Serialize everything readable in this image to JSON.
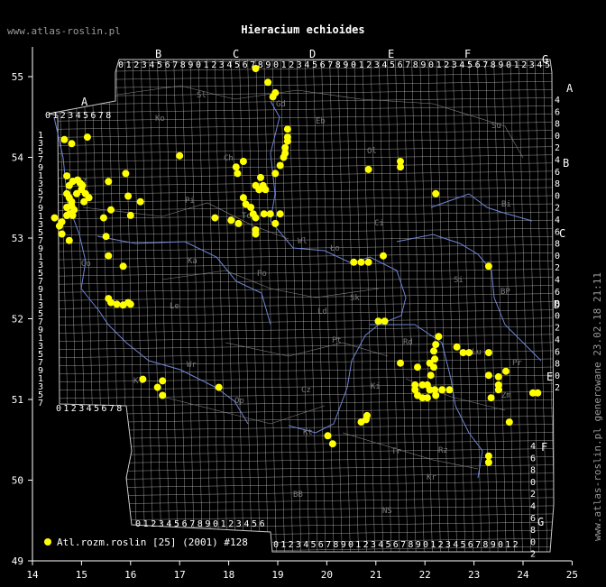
{
  "site_url": "www.atlas-roslin.pl",
  "title": "Hieracium echioides",
  "side_stamp": "www.atlas-roslin.pl generowane 23.02.18 21:11",
  "legend": {
    "label": "Atl.rozm.roslin [25] (2001) #128",
    "color": "#ffff00"
  },
  "axes": {
    "lon_ticks": [
      "14",
      "15",
      "16",
      "17",
      "18",
      "19",
      "20",
      "21",
      "22",
      "23",
      "24",
      "25"
    ],
    "lat_ticks": [
      "55",
      "54",
      "53",
      "52",
      "51",
      "50",
      "49"
    ]
  },
  "grid_letters_top": [
    "A",
    "B",
    "C",
    "D",
    "E",
    "F",
    "G"
  ],
  "grid_letters_right": [
    "A",
    "B",
    "C",
    "D",
    "E",
    "F",
    "G"
  ],
  "grid_digits": "0123456789",
  "region_labels": [
    "Sl",
    "Ko",
    "Gd",
    "Eb",
    "Su",
    "Ol",
    "Ch",
    "Sz",
    "Pi",
    "Bi",
    "Ci",
    "To",
    "Wl",
    "Ło",
    "Go",
    "Ka",
    "Po",
    "Si",
    "Le",
    "Ld",
    "Sk",
    "BP",
    "Pt",
    "Rd",
    "Lu",
    "Wr",
    "Op",
    "Cz",
    "Ki",
    "Zm",
    "Kt",
    "Tr",
    "Kr",
    "BB",
    "NS",
    "Rz",
    "Kl",
    "Pr"
  ],
  "colors": {
    "background": "#000000",
    "grid": "#c8c8c8",
    "river": "#6f86d6",
    "point": "#ffff00",
    "text": "#ffffff"
  },
  "points": [
    [
      14.65,
      54.22
    ],
    [
      14.8,
      54.17
    ],
    [
      15.12,
      54.25
    ],
    [
      14.7,
      53.77
    ],
    [
      14.75,
      53.65
    ],
    [
      14.82,
      53.7
    ],
    [
      14.92,
      53.72
    ],
    [
      14.97,
      53.68
    ],
    [
      15.02,
      53.65
    ],
    [
      14.7,
      53.55
    ],
    [
      14.75,
      53.5
    ],
    [
      14.8,
      53.45
    ],
    [
      14.9,
      53.55
    ],
    [
      15.0,
      53.6
    ],
    [
      15.08,
      53.55
    ],
    [
      15.15,
      53.5
    ],
    [
      15.05,
      53.45
    ],
    [
      14.8,
      53.4
    ],
    [
      14.7,
      53.38
    ],
    [
      14.85,
      53.35
    ],
    [
      14.75,
      53.3
    ],
    [
      14.7,
      53.28
    ],
    [
      14.82,
      53.28
    ],
    [
      14.6,
      53.2
    ],
    [
      14.55,
      53.15
    ],
    [
      14.45,
      53.25
    ],
    [
      14.6,
      53.05
    ],
    [
      14.75,
      52.97
    ],
    [
      15.45,
      53.25
    ],
    [
      15.55,
      53.7
    ],
    [
      15.9,
      53.8
    ],
    [
      15.95,
      53.52
    ],
    [
      16.2,
      53.45
    ],
    [
      15.6,
      53.35
    ],
    [
      16.0,
      53.28
    ],
    [
      15.5,
      53.02
    ],
    [
      15.55,
      52.78
    ],
    [
      15.85,
      52.65
    ],
    [
      15.55,
      52.25
    ],
    [
      15.6,
      52.2
    ],
    [
      15.72,
      52.18
    ],
    [
      15.85,
      52.17
    ],
    [
      15.95,
      52.2
    ],
    [
      16.0,
      52.18
    ],
    [
      16.25,
      51.25
    ],
    [
      16.55,
      51.15
    ],
    [
      16.65,
      51.05
    ],
    [
      16.65,
      51.23
    ],
    [
      17.0,
      54.02
    ],
    [
      17.8,
      51.15
    ],
    [
      17.72,
      53.25
    ],
    [
      18.05,
      53.22
    ],
    [
      18.2,
      53.18
    ],
    [
      18.15,
      53.88
    ],
    [
      18.18,
      53.8
    ],
    [
      18.3,
      53.95
    ],
    [
      18.3,
      53.5
    ],
    [
      18.35,
      53.42
    ],
    [
      18.45,
      53.38
    ],
    [
      18.5,
      53.3
    ],
    [
      18.55,
      53.65
    ],
    [
      18.62,
      53.6
    ],
    [
      18.65,
      53.75
    ],
    [
      18.7,
      53.65
    ],
    [
      18.75,
      53.6
    ],
    [
      18.55,
      53.25
    ],
    [
      18.72,
      53.3
    ],
    [
      18.85,
      53.3
    ],
    [
      19.05,
      53.3
    ],
    [
      18.95,
      53.18
    ],
    [
      18.55,
      53.1
    ],
    [
      18.55,
      53.05
    ],
    [
      18.95,
      53.8
    ],
    [
      19.05,
      53.9
    ],
    [
      19.12,
      54.0
    ],
    [
      19.15,
      54.05
    ],
    [
      19.15,
      54.12
    ],
    [
      19.2,
      54.2
    ],
    [
      19.2,
      54.25
    ],
    [
      19.2,
      54.35
    ],
    [
      18.9,
      54.75
    ],
    [
      18.95,
      54.8
    ],
    [
      18.8,
      54.93
    ],
    [
      18.55,
      55.1
    ],
    [
      20.85,
      53.85
    ],
    [
      21.5,
      53.95
    ],
    [
      21.5,
      53.88
    ],
    [
      22.22,
      53.55
    ],
    [
      20.55,
      52.7
    ],
    [
      20.7,
      52.7
    ],
    [
      20.85,
      52.7
    ],
    [
      21.15,
      52.78
    ],
    [
      21.05,
      51.97
    ],
    [
      21.18,
      51.97
    ],
    [
      23.3,
      52.65
    ],
    [
      21.5,
      51.45
    ],
    [
      21.85,
      51.4
    ],
    [
      22.12,
      51.3
    ],
    [
      22.18,
      51.4
    ],
    [
      22.1,
      51.45
    ],
    [
      22.2,
      51.5
    ],
    [
      22.18,
      51.6
    ],
    [
      22.22,
      51.68
    ],
    [
      22.28,
      51.78
    ],
    [
      22.65,
      51.65
    ],
    [
      22.78,
      51.58
    ],
    [
      22.9,
      51.58
    ],
    [
      23.3,
      51.58
    ],
    [
      23.65,
      51.35
    ],
    [
      23.5,
      51.28
    ],
    [
      23.3,
      51.3
    ],
    [
      23.5,
      51.18
    ],
    [
      23.5,
      51.12
    ],
    [
      23.35,
      51.02
    ],
    [
      21.8,
      51.12
    ],
    [
      21.85,
      51.05
    ],
    [
      21.95,
      51.02
    ],
    [
      22.05,
      51.02
    ],
    [
      22.1,
      51.12
    ],
    [
      22.2,
      51.12
    ],
    [
      22.35,
      51.12
    ],
    [
      22.5,
      51.12
    ],
    [
      21.8,
      51.18
    ],
    [
      21.95,
      51.18
    ],
    [
      22.05,
      51.18
    ],
    [
      22.22,
      51.05
    ],
    [
      20.7,
      50.72
    ],
    [
      20.8,
      50.75
    ],
    [
      20.82,
      50.8
    ],
    [
      20.02,
      50.55
    ],
    [
      20.12,
      50.45
    ],
    [
      23.3,
      50.3
    ],
    [
      23.3,
      50.22
    ],
    [
      23.72,
      50.72
    ],
    [
      24.2,
      51.08
    ],
    [
      24.3,
      51.08
    ]
  ]
}
